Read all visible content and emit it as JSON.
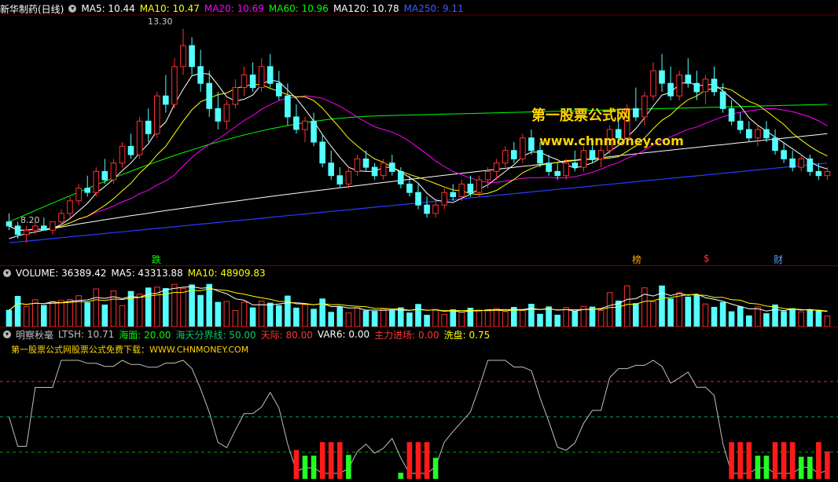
{
  "stock": {
    "name": "新华制药(日线)",
    "high_label": "13.30",
    "low_label": "8.20"
  },
  "ma_header": [
    {
      "label": "MA5: 10.44",
      "color": "#ffffff"
    },
    {
      "label": "MA10: 10.47",
      "color": "#ffff00"
    },
    {
      "label": "MA20: 10.69",
      "color": "#ff00ff"
    },
    {
      "label": "MA60: 10.96",
      "color": "#00ff00"
    },
    {
      "label": "MA120: 10.78",
      "color": "#ffffff"
    },
    {
      "label": "MA250: 9.11",
      "color": "#3a5cff"
    }
  ],
  "volume_header": [
    {
      "label": "VOLUME: 36389.42",
      "color": "#ffffff"
    },
    {
      "label": "MA5: 43313.88",
      "color": "#ffffff"
    },
    {
      "label": "MA10: 48909.83",
      "color": "#ffff00"
    }
  ],
  "indicator_header": {
    "name": "明察秋毫",
    "items": [
      {
        "label": "LTSH: 10.71",
        "color": "#c0c0c0"
      },
      {
        "label": "海面: 20.00",
        "color": "#00ff00"
      },
      {
        "label": "海天分界线: 50.00",
        "color": "#00cc66"
      },
      {
        "label": "天际: 80.00",
        "color": "#ff3333"
      },
      {
        "label": "VAR6: 0.00",
        "color": "#ffffff"
      },
      {
        "label": "主力进场: 0.00",
        "color": "#ff3333"
      },
      {
        "label": "洗盘: 0.75",
        "color": "#ffff00"
      }
    ]
  },
  "promo_text": "第一股票公式网股票公式免费下载：WWW.CHNMONEY.COM",
  "watermark": {
    "line1": "第一股票公式网",
    "line2": "www.chnmoney.com"
  },
  "events": [
    {
      "label": "跌",
      "color": "#00ff00"
    },
    {
      "label": "榜",
      "color": "#ffa500"
    },
    {
      "label": "$",
      "color": "#ff3333"
    },
    {
      "label": "财",
      "color": "#5b9bff"
    }
  ],
  "colors": {
    "up": "#ff3030",
    "down": "#54ffff",
    "ma5": "#ffffff",
    "ma10": "#ffff00",
    "ma20": "#ff00ff",
    "ma60": "#00ff00",
    "ma120": "#ffffff",
    "ma250": "#2a3cff"
  },
  "chart_data": {
    "type": "candlestick",
    "price_range": [
      8.0,
      13.5
    ],
    "candles": [
      [
        8.7,
        8.9,
        8.5,
        8.6
      ],
      [
        8.6,
        8.7,
        8.3,
        8.4
      ],
      [
        8.4,
        8.6,
        8.2,
        8.5
      ],
      [
        8.5,
        8.7,
        8.4,
        8.6
      ],
      [
        8.6,
        8.8,
        8.5,
        8.5
      ],
      [
        8.5,
        8.7,
        8.4,
        8.7
      ],
      [
        8.7,
        9.0,
        8.6,
        8.9
      ],
      [
        8.9,
        9.3,
        8.8,
        9.2
      ],
      [
        9.2,
        9.6,
        9.1,
        9.5
      ],
      [
        9.5,
        9.8,
        9.3,
        9.4
      ],
      [
        9.4,
        10.0,
        9.3,
        9.9
      ],
      [
        9.9,
        10.2,
        9.6,
        9.7
      ],
      [
        9.7,
        10.2,
        9.6,
        10.1
      ],
      [
        10.1,
        10.6,
        10.0,
        10.5
      ],
      [
        10.5,
        10.8,
        10.2,
        10.3
      ],
      [
        10.3,
        11.2,
        10.2,
        11.1
      ],
      [
        11.1,
        11.4,
        10.6,
        10.8
      ],
      [
        10.8,
        11.8,
        10.7,
        11.7
      ],
      [
        11.7,
        12.2,
        11.3,
        11.5
      ],
      [
        11.5,
        12.6,
        11.4,
        12.4
      ],
      [
        12.4,
        13.3,
        12.2,
        12.9
      ],
      [
        12.9,
        13.1,
        12.2,
        12.4
      ],
      [
        12.4,
        12.8,
        11.8,
        12.0
      ],
      [
        12.0,
        12.3,
        11.2,
        11.4
      ],
      [
        11.4,
        11.8,
        10.9,
        11.1
      ],
      [
        11.1,
        11.6,
        10.9,
        11.5
      ],
      [
        11.5,
        12.1,
        11.4,
        11.9
      ],
      [
        11.9,
        12.4,
        11.7,
        12.2
      ],
      [
        12.2,
        12.5,
        11.8,
        11.9
      ],
      [
        11.9,
        12.6,
        11.8,
        12.4
      ],
      [
        12.4,
        12.7,
        11.9,
        12.0
      ],
      [
        12.0,
        12.3,
        11.6,
        11.7
      ],
      [
        11.7,
        12.0,
        11.0,
        11.2
      ],
      [
        11.2,
        11.5,
        10.8,
        10.9
      ],
      [
        10.9,
        11.2,
        10.6,
        11.1
      ],
      [
        11.1,
        11.3,
        10.5,
        10.6
      ],
      [
        10.6,
        10.8,
        10.0,
        10.1
      ],
      [
        10.1,
        10.4,
        9.7,
        9.8
      ],
      [
        9.8,
        10.0,
        9.5,
        9.6
      ],
      [
        9.6,
        10.0,
        9.5,
        9.9
      ],
      [
        9.9,
        10.3,
        9.8,
        10.2
      ],
      [
        10.2,
        10.4,
        9.9,
        10.0
      ],
      [
        10.0,
        10.1,
        9.7,
        9.8
      ],
      [
        9.8,
        10.2,
        9.7,
        10.1
      ],
      [
        10.1,
        10.3,
        9.8,
        9.9
      ],
      [
        9.9,
        10.0,
        9.5,
        9.6
      ],
      [
        9.6,
        9.8,
        9.3,
        9.4
      ],
      [
        9.4,
        9.6,
        9.0,
        9.1
      ],
      [
        9.1,
        9.3,
        8.8,
        8.9
      ],
      [
        8.9,
        9.2,
        8.8,
        9.1
      ],
      [
        9.1,
        9.5,
        9.0,
        9.4
      ],
      [
        9.4,
        9.6,
        9.2,
        9.3
      ],
      [
        9.3,
        9.7,
        9.2,
        9.6
      ],
      [
        9.6,
        9.8,
        9.3,
        9.4
      ],
      [
        9.4,
        9.8,
        9.3,
        9.7
      ],
      [
        9.7,
        10.0,
        9.5,
        9.9
      ],
      [
        9.9,
        10.2,
        9.7,
        10.1
      ],
      [
        10.1,
        10.5,
        10.0,
        10.4
      ],
      [
        10.4,
        10.6,
        10.1,
        10.2
      ],
      [
        10.2,
        10.8,
        10.1,
        10.7
      ],
      [
        10.7,
        10.9,
        10.3,
        10.4
      ],
      [
        10.4,
        10.6,
        10.0,
        10.1
      ],
      [
        10.1,
        10.3,
        9.8,
        9.9
      ],
      [
        9.9,
        10.1,
        9.7,
        9.8
      ],
      [
        9.8,
        10.2,
        9.7,
        10.1
      ],
      [
        10.1,
        10.4,
        9.9,
        10.0
      ],
      [
        10.0,
        10.5,
        9.9,
        10.4
      ],
      [
        10.4,
        10.7,
        10.1,
        10.2
      ],
      [
        10.2,
        10.5,
        10.0,
        10.4
      ],
      [
        10.4,
        11.0,
        10.3,
        10.9
      ],
      [
        10.9,
        11.3,
        10.6,
        10.7
      ],
      [
        10.7,
        11.5,
        10.6,
        11.4
      ],
      [
        11.4,
        11.9,
        11.1,
        11.2
      ],
      [
        11.2,
        11.8,
        11.0,
        11.7
      ],
      [
        11.7,
        12.5,
        11.6,
        12.3
      ],
      [
        12.3,
        12.7,
        11.8,
        12.0
      ],
      [
        12.0,
        12.4,
        11.6,
        11.7
      ],
      [
        11.7,
        12.3,
        11.6,
        12.2
      ],
      [
        12.2,
        12.6,
        11.9,
        12.0
      ],
      [
        12.0,
        12.3,
        11.6,
        11.8
      ],
      [
        11.8,
        12.2,
        11.5,
        12.1
      ],
      [
        12.1,
        12.4,
        11.7,
        11.8
      ],
      [
        11.8,
        12.0,
        11.3,
        11.4
      ],
      [
        11.4,
        11.6,
        11.0,
        11.1
      ],
      [
        11.1,
        11.3,
        10.8,
        10.9
      ],
      [
        10.9,
        11.1,
        10.6,
        10.7
      ],
      [
        10.7,
        11.0,
        10.5,
        10.9
      ],
      [
        10.9,
        11.1,
        10.6,
        10.7
      ],
      [
        10.7,
        10.9,
        10.3,
        10.4
      ],
      [
        10.4,
        10.6,
        10.1,
        10.2
      ],
      [
        10.2,
        10.4,
        9.9,
        10.0
      ],
      [
        10.0,
        10.3,
        9.9,
        10.2
      ],
      [
        10.2,
        10.3,
        9.8,
        9.9
      ],
      [
        9.9,
        10.1,
        9.7,
        9.8
      ],
      [
        9.8,
        10.0,
        9.7,
        9.9
      ]
    ],
    "volume_range": [
      0,
      130000
    ],
    "indicator_range": [
      0,
      100
    ],
    "indicator_levels": [
      20,
      50,
      80
    ]
  }
}
